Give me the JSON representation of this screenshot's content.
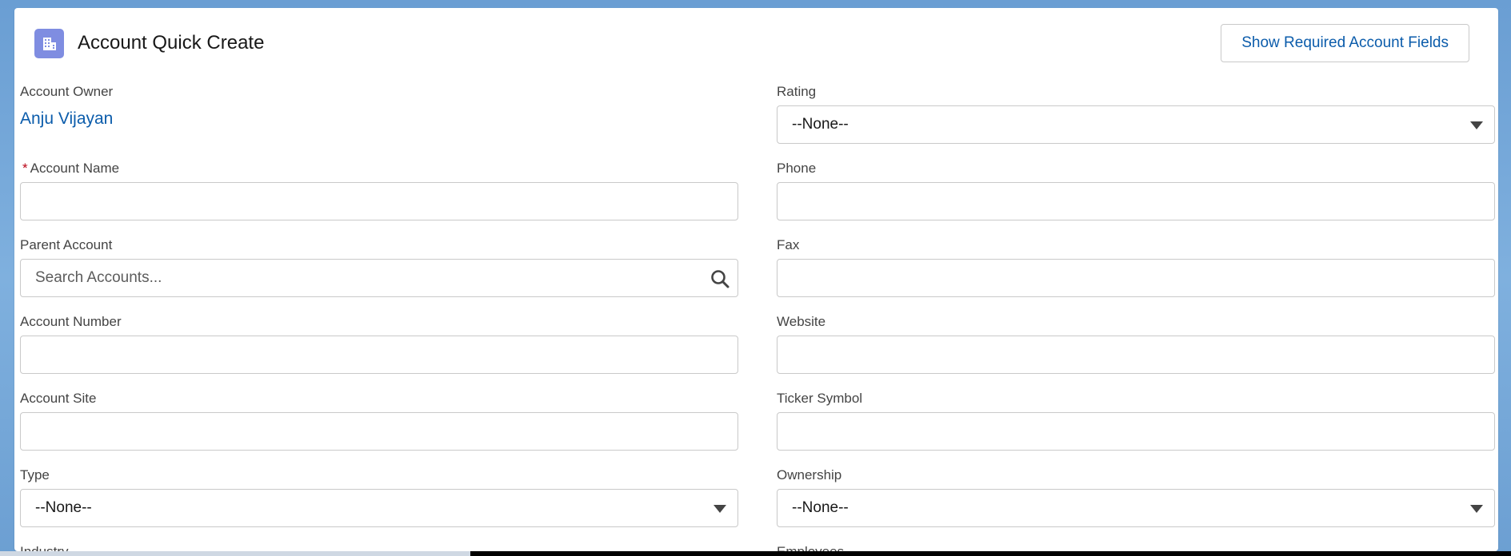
{
  "header": {
    "title": "Account Quick Create",
    "icon": "account-building-icon",
    "required_button_label": "Show Required Account Fields"
  },
  "colors": {
    "accent_link": "#0b5cab",
    "icon_bg": "#7f8de1",
    "required_star": "#ba0517"
  },
  "fields": {
    "account_owner": {
      "label": "Account Owner",
      "value": "Anju Vijayan"
    },
    "account_name": {
      "label": "Account Name",
      "required_marker": "*",
      "value": ""
    },
    "parent_account": {
      "label": "Parent Account",
      "placeholder": "Search Accounts..."
    },
    "account_number": {
      "label": "Account Number",
      "value": ""
    },
    "account_site": {
      "label": "Account Site",
      "value": ""
    },
    "type": {
      "label": "Type",
      "selected": "--None--"
    },
    "industry": {
      "label": "Industry"
    },
    "rating": {
      "label": "Rating",
      "selected": "--None--"
    },
    "phone": {
      "label": "Phone",
      "value": ""
    },
    "fax": {
      "label": "Fax",
      "value": ""
    },
    "website": {
      "label": "Website",
      "value": ""
    },
    "ticker_symbol": {
      "label": "Ticker Symbol",
      "value": ""
    },
    "ownership": {
      "label": "Ownership",
      "selected": "--None--"
    },
    "employees": {
      "label": "Employees"
    }
  }
}
